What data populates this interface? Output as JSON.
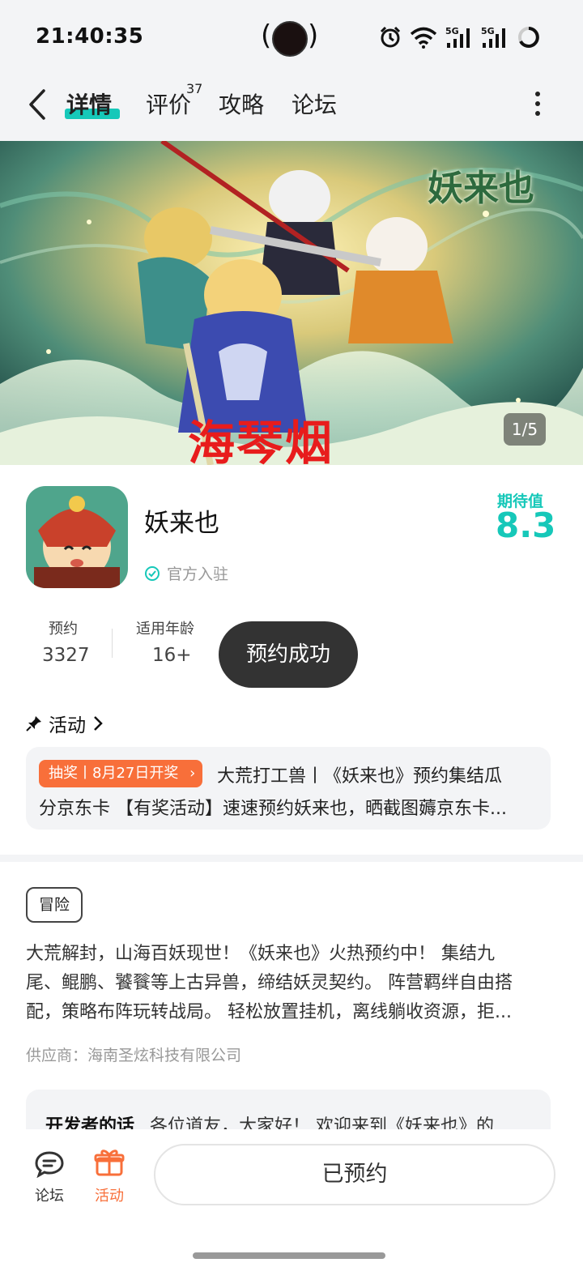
{
  "status_bar": {
    "time": "21:40:35",
    "network": "5G"
  },
  "nav": {
    "tabs": [
      "详情",
      "评价",
      "攻略",
      "论坛"
    ],
    "reviews_count": "37"
  },
  "banner": {
    "watermark": "海琴烟",
    "logo_text": "妖来也",
    "counter": "1/5"
  },
  "game": {
    "name": "妖来也",
    "verified_label": "官方入驻",
    "expect_label": "期待值",
    "expect_score": "8.3"
  },
  "stats": [
    {
      "label": "预约",
      "value": "3327"
    },
    {
      "label": "适用年龄",
      "value": "16+"
    }
  ],
  "toast": "预约成功",
  "activity": {
    "header": "活动",
    "badge": "抽奖丨8月27日开奖",
    "line1": "大荒打工兽丨《妖来也》预约集结瓜",
    "line2": "分京东卡 【有奖活动】速速预约妖来也，晒截图薅京东卡..."
  },
  "description": {
    "tag": "冒险",
    "lines": [
      "大荒解封，山海百妖现世！《妖来也》火热预约中！ 集结九",
      "尾、鲲鹏、饕餮等上古异兽，缔结妖灵契约。 阵营羁绊自由搭",
      "配，策略布阵玩转战局。 轻松放置挂机，离线躺收资源，拒..."
    ],
    "supplier": "供应商：海南圣炫科技有限公司"
  },
  "developer": {
    "label": "开发者的话",
    "text": "各位道友，大家好！ 欢迎来到《妖来也》的"
  },
  "bottom_bar": {
    "forum_label": "论坛",
    "activity_label": "活动",
    "reserved_label": "已预约"
  },
  "colors": {
    "accent_teal": "#16c8b9",
    "accent_orange": "#f86f3a",
    "toast_bg": "#333333"
  }
}
